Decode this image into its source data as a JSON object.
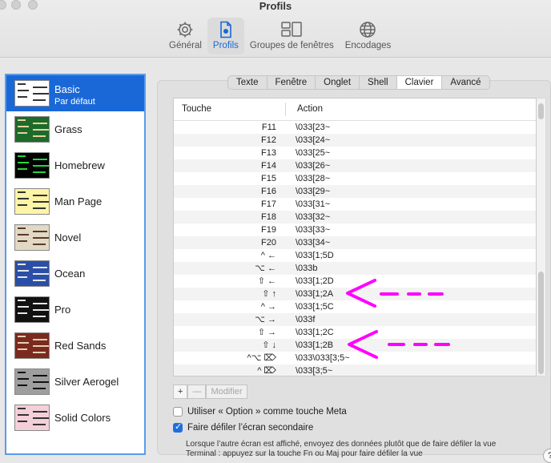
{
  "window": {
    "title": "Profils"
  },
  "toolbar": {
    "tabs": [
      {
        "label": "Général",
        "icon": "gear-icon"
      },
      {
        "label": "Profils",
        "icon": "profiles-icon",
        "active": true
      },
      {
        "label": "Groupes de fenêtres",
        "icon": "window-groups-icon"
      },
      {
        "label": "Encodages",
        "icon": "globe-icon"
      }
    ]
  },
  "sidebar": {
    "profiles": [
      {
        "name": "Basic",
        "subtitle": "Par défaut",
        "selected": true,
        "bg": "#ffffff",
        "fg": "#333333"
      },
      {
        "name": "Grass",
        "bg": "#1c6b2b",
        "fg": "#e7d0a0"
      },
      {
        "name": "Homebrew",
        "bg": "#000000",
        "fg": "#27d63a"
      },
      {
        "name": "Man Page",
        "bg": "#fdf4a6",
        "fg": "#333333"
      },
      {
        "name": "Novel",
        "bg": "#e2d9c4",
        "fg": "#5a3a2a"
      },
      {
        "name": "Ocean",
        "bg": "#2b4fa8",
        "fg": "#e6e6e6"
      },
      {
        "name": "Pro",
        "bg": "#111111",
        "fg": "#e6e6e6"
      },
      {
        "name": "Red Sands",
        "bg": "#7a2a1f",
        "fg": "#e6cfb0"
      },
      {
        "name": "Silver Aerogel",
        "bg": "#9e9e9e",
        "fg": "#111111"
      },
      {
        "name": "Solid Colors",
        "bg": "#f4cfd9",
        "fg": "#333333"
      }
    ]
  },
  "subtabs": [
    "Texte",
    "Fenêtre",
    "Onglet",
    "Shell",
    "Clavier",
    "Avancé"
  ],
  "subtab_active": "Clavier",
  "table": {
    "headers": [
      "Touche",
      "Action"
    ],
    "rows": [
      {
        "key": "F11",
        "action": "\\033[23~"
      },
      {
        "key": "F12",
        "action": "\\033[24~"
      },
      {
        "key": "F13",
        "action": "\\033[25~"
      },
      {
        "key": "F14",
        "action": "\\033[26~"
      },
      {
        "key": "F15",
        "action": "\\033[28~"
      },
      {
        "key": "F16",
        "action": "\\033[29~"
      },
      {
        "key": "F17",
        "action": "\\033[31~"
      },
      {
        "key": "F18",
        "action": "\\033[32~"
      },
      {
        "key": "F19",
        "action": "\\033[33~"
      },
      {
        "key": "F20",
        "action": "\\033[34~"
      },
      {
        "key": "^ ←",
        "action": "\\033[1;5D"
      },
      {
        "key": "⌥ ←",
        "action": "\\033b"
      },
      {
        "key": "⇧ ←",
        "action": "\\033[1;2D"
      },
      {
        "key": "⇧ ↑",
        "action": "\\033[1;2A"
      },
      {
        "key": "^ →",
        "action": "\\033[1;5C"
      },
      {
        "key": "⌥ →",
        "action": "\\033f"
      },
      {
        "key": "⇧ →",
        "action": "\\033[1;2C"
      },
      {
        "key": "⇧ ↓",
        "action": "\\033[1;2B"
      },
      {
        "key": "^⌥ ⌦",
        "action": "\\033\\033[3;5~"
      },
      {
        "key": "^ ⌦",
        "action": "\\033[3;5~"
      }
    ]
  },
  "buttons": {
    "add": "+",
    "remove": "—",
    "modify": "Modifier"
  },
  "options": [
    {
      "label": "Utiliser « Option » comme touche Meta",
      "checked": false
    },
    {
      "label": "Faire défiler l’écran secondaire",
      "checked": true
    }
  ],
  "note_lines": [
    "Lorsque l’autre écran est affiché, envoyez des données plutôt que de faire défiler la vue",
    "Terminal : appuyez sur la touche Fn ou Maj pour faire défiler la vue"
  ],
  "help": "?",
  "annotation_color": "#ff00ff"
}
